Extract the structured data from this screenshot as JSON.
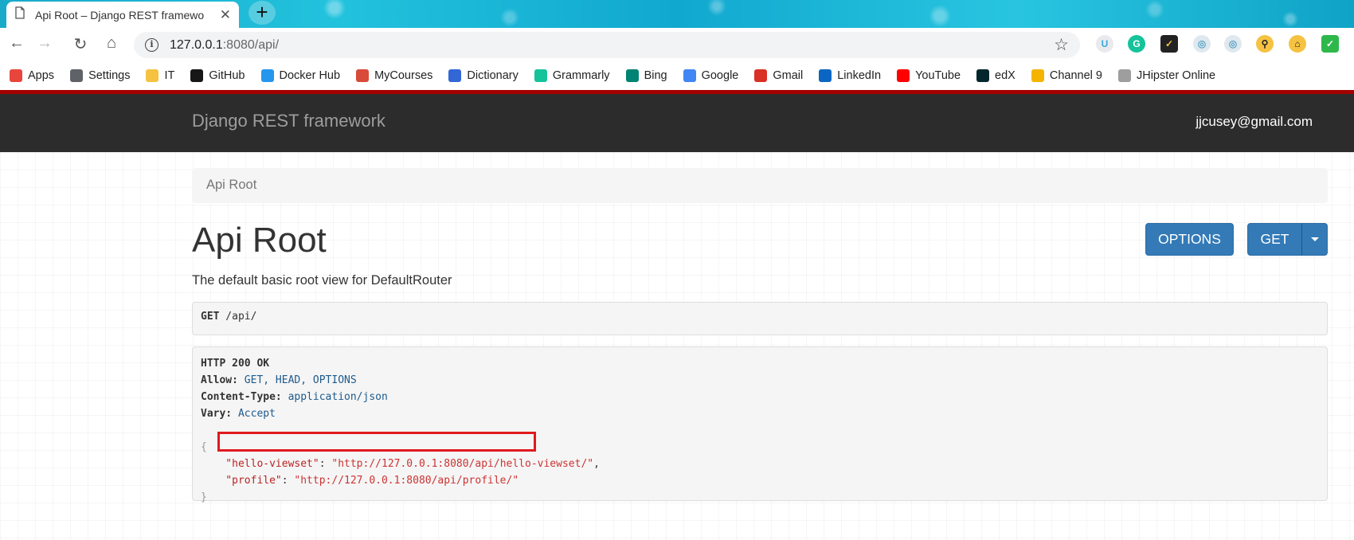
{
  "browser": {
    "tab_title": "Api Root – Django REST framewo",
    "tab_close": "✕",
    "new_tab": "+",
    "url_host": "127.0.0.1",
    "url_rest": ":8080/api/",
    "nav": {
      "back": "←",
      "forward": "→",
      "reload": "↻",
      "home": "⌂"
    },
    "star": "☆"
  },
  "bookmarks": [
    {
      "label": "Apps",
      "icon": "apps-grid-icon",
      "color": "#e8453c"
    },
    {
      "label": "Settings",
      "icon": "gear-icon",
      "color": "#5f6368"
    },
    {
      "label": "IT",
      "icon": "folder-icon",
      "color": "#f5c242"
    },
    {
      "label": "GitHub",
      "icon": "github-icon",
      "color": "#181717"
    },
    {
      "label": "Docker Hub",
      "icon": "docker-icon",
      "color": "#2496ed"
    },
    {
      "label": "MyCourses",
      "icon": "mycourses-icon",
      "color": "#d84a3a"
    },
    {
      "label": "Dictionary",
      "icon": "dictionary-icon",
      "color": "#3367d6"
    },
    {
      "label": "Grammarly",
      "icon": "grammarly-icon",
      "color": "#15c39a"
    },
    {
      "label": "Bing",
      "icon": "bing-icon",
      "color": "#008373"
    },
    {
      "label": "Google",
      "icon": "google-icon",
      "color": "#4285f4"
    },
    {
      "label": "Gmail",
      "icon": "gmail-icon",
      "color": "#d93025"
    },
    {
      "label": "LinkedIn",
      "icon": "linkedin-icon",
      "color": "#0a66c2"
    },
    {
      "label": "YouTube",
      "icon": "youtube-icon",
      "color": "#ff0000"
    },
    {
      "label": "edX",
      "icon": "edx-icon",
      "color": "#02262b"
    },
    {
      "label": "Channel 9",
      "icon": "channel9-icon",
      "color": "#f4b400"
    },
    {
      "label": "JHipster Online",
      "icon": "jhipster-icon",
      "color": "#9e9e9e"
    }
  ],
  "navbar": {
    "brand": "Django REST framework",
    "user": "jjcusey@gmail.com",
    "accent": "#a30000"
  },
  "page": {
    "breadcrumb": "Api Root",
    "title": "Api Root",
    "description": "The default basic root view for DefaultRouter",
    "buttons": {
      "options": "OPTIONS",
      "get": "GET"
    },
    "request": {
      "method": "GET",
      "path": " /api/"
    },
    "response": {
      "status": "HTTP 200 OK",
      "allow_label": "Allow:",
      "allow_value": " GET, HEAD, OPTIONS",
      "content_type_label": "Content-Type:",
      "content_type_value": " application/json",
      "vary_label": "Vary:",
      "vary_value": " Accept",
      "open_brace": "{",
      "line1_key": "    \"hello-viewset\"",
      "line1_sep": ": ",
      "line1_value": "\"http://127.0.0.1:8080/api/hello-viewset/\"",
      "line1_comma": ",",
      "line2_key": "    \"profile\"",
      "line2_sep": ": ",
      "line2_value": "\"http://127.0.0.1:8080/api/profile/\"",
      "close_brace": "}"
    },
    "primary_color": "#337ab7",
    "highlight_color": "#e0191f"
  }
}
